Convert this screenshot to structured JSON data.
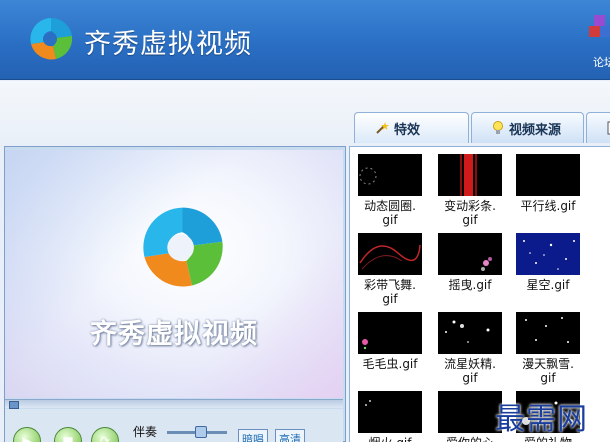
{
  "app": {
    "title": "齐秀虚拟视频"
  },
  "header": {
    "forum_label": "论坛"
  },
  "tabs": [
    {
      "label": "特效",
      "icon": "wand-icon",
      "active": true
    },
    {
      "label": "视频来源",
      "icon": "bulb-icon",
      "active": false
    },
    {
      "label": "",
      "icon": "doc-icon",
      "active": false
    }
  ],
  "preview": {
    "title": "齐秀虚拟视频"
  },
  "controls": {
    "play_icon": "▶",
    "stop_icon": "■",
    "record_icon": "⟳",
    "accompaniment_label": "伴奏",
    "btn_1": "暗唱",
    "btn_2": "高清"
  },
  "effects": [
    {
      "line1": "动态圆圈.",
      "line2": "gif",
      "style": "circle"
    },
    {
      "line1": "变动彩条.",
      "line2": "gif",
      "style": "stripe"
    },
    {
      "line1": "平行线.gif",
      "line2": "",
      "style": "blank"
    },
    {
      "line1": "彩带飞舞.",
      "line2": "gif",
      "style": "ribbon"
    },
    {
      "line1": "摇曳.gif",
      "line2": "",
      "style": "sway"
    },
    {
      "line1": "星空.gif",
      "line2": "",
      "style": "stars"
    },
    {
      "line1": "毛毛虫.gif",
      "line2": "",
      "style": "caterpillar"
    },
    {
      "line1": "流星妖精.",
      "line2": "gif",
      "style": "meteor"
    },
    {
      "line1": "漫天飘雪.",
      "line2": "gif",
      "style": "snow"
    },
    {
      "line1": "烟火.gif",
      "line2": "",
      "style": "firework"
    },
    {
      "line1": "爱你的心",
      "line2": "",
      "style": "heart"
    },
    {
      "line1": "爱的礼物",
      "line2": "",
      "style": "gift"
    }
  ],
  "watermark": "最需网"
}
